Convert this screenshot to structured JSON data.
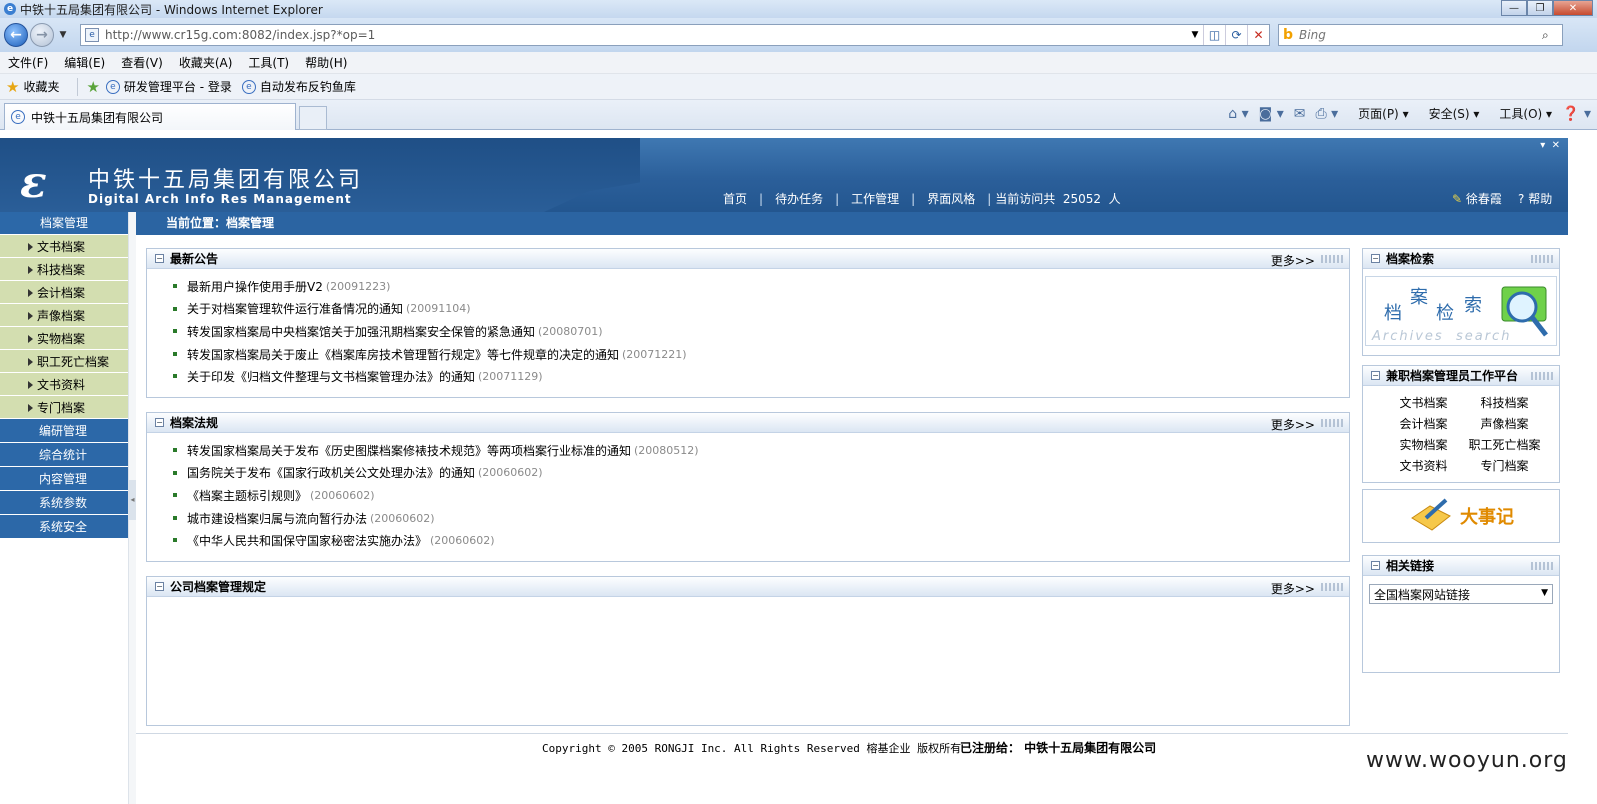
{
  "browser": {
    "window_title": "中铁十五局集团有限公司 - Windows Internet Explorer",
    "url": "http://www.cr15g.com:8082/index.jsp?*op=1",
    "search_placeholder": "Bing",
    "menu": [
      "文件(F)",
      "编辑(E)",
      "查看(V)",
      "收藏夹(A)",
      "工具(T)",
      "帮助(H)"
    ],
    "favorites_label": "收藏夹",
    "fav_links": [
      "研发管理平台 - 登录",
      "自动发布反钓鱼库"
    ],
    "tab_title": "中铁十五局集团有限公司",
    "cmd": {
      "page": "页面(P)",
      "safety": "安全(S)",
      "tools": "工具(O)"
    }
  },
  "site": {
    "name_cn": "中铁十五局集团有限公司",
    "name_en": "Digital Arch Info Res Management",
    "nav": [
      "首页",
      "待办任务",
      "工作管理",
      "界面风格"
    ],
    "visitor_text": "当前访问共  25052  人",
    "user": "徐春霞",
    "help": "帮助",
    "breadcrumb": "当前位置：档案管理"
  },
  "sidebar": {
    "head": "档案管理",
    "sub_items": [
      "文书档案",
      "科技档案",
      "会计档案",
      "声像档案",
      "实物档案",
      "职工死亡档案",
      "文书资料",
      "专门档案"
    ],
    "main_items": [
      "编研管理",
      "综合统计",
      "内容管理",
      "系统参数",
      "系统安全"
    ]
  },
  "panels": {
    "more_label": "更多>>",
    "notices": {
      "title": "最新公告",
      "items": [
        {
          "text": "最新用户操作使用手册V2",
          "date": "(20091223)"
        },
        {
          "text": "关于对档案管理软件运行准备情况的通知",
          "date": "(20091104)"
        },
        {
          "text": "转发国家档案局中央档案馆关于加强汛期档案安全保管的紧急通知",
          "date": "(20080701)"
        },
        {
          "text": "转发国家档案局关于废止《档案库房技术管理暂行规定》等七件规章的决定的通知",
          "date": "(20071221)"
        },
        {
          "text": "关于印发《归档文件整理与文书档案管理办法》的通知",
          "date": "(20071129)"
        }
      ]
    },
    "laws": {
      "title": "档案法规",
      "items": [
        {
          "text": "转发国家档案局关于发布《历史图牒档案修裱技术规范》等两项档案行业标准的通知",
          "date": "(20080512)"
        },
        {
          "text": "国务院关于发布《国家行政机关公文处理办法》的通知",
          "date": "(20060602)"
        },
        {
          "text": "《档案主题标引规则》",
          "date": "(20060602)"
        },
        {
          "text": "城市建设档案归属与流向暂行办法",
          "date": "(20060602)"
        },
        {
          "text": "《中华人民共和国保守国家秘密法实施办法》",
          "date": "(20060602)"
        }
      ]
    },
    "rules": {
      "title": "公司档案管理规定"
    },
    "search": {
      "title": "档案检索",
      "chars": [
        "档",
        "案",
        "检",
        "索"
      ],
      "en": "Archives  search"
    },
    "platform": {
      "title": "兼职档案管理员工作平台",
      "items": [
        "文书档案",
        "科技档案",
        "会计档案",
        "声像档案",
        "实物档案",
        "职工死亡档案",
        "文书资料",
        "专门档案"
      ]
    },
    "events": {
      "label": "大事记"
    },
    "links": {
      "title": "相关链接",
      "select_value": "全国档案网站链接"
    }
  },
  "footer": {
    "copyright": "Copyright © 2005 RONGJI Inc. All Rights Reserved 榕基企业 版权所有",
    "registered": "已注册给： 中铁十五局集团有限公司"
  },
  "watermark": "www.wooyun.org",
  "colors": {
    "header_blue": "#2b5f9a",
    "sidebar_blue": "#2c68a8",
    "sidebar_sub": "#d3deb0",
    "accent_orange": "#e08a00"
  }
}
